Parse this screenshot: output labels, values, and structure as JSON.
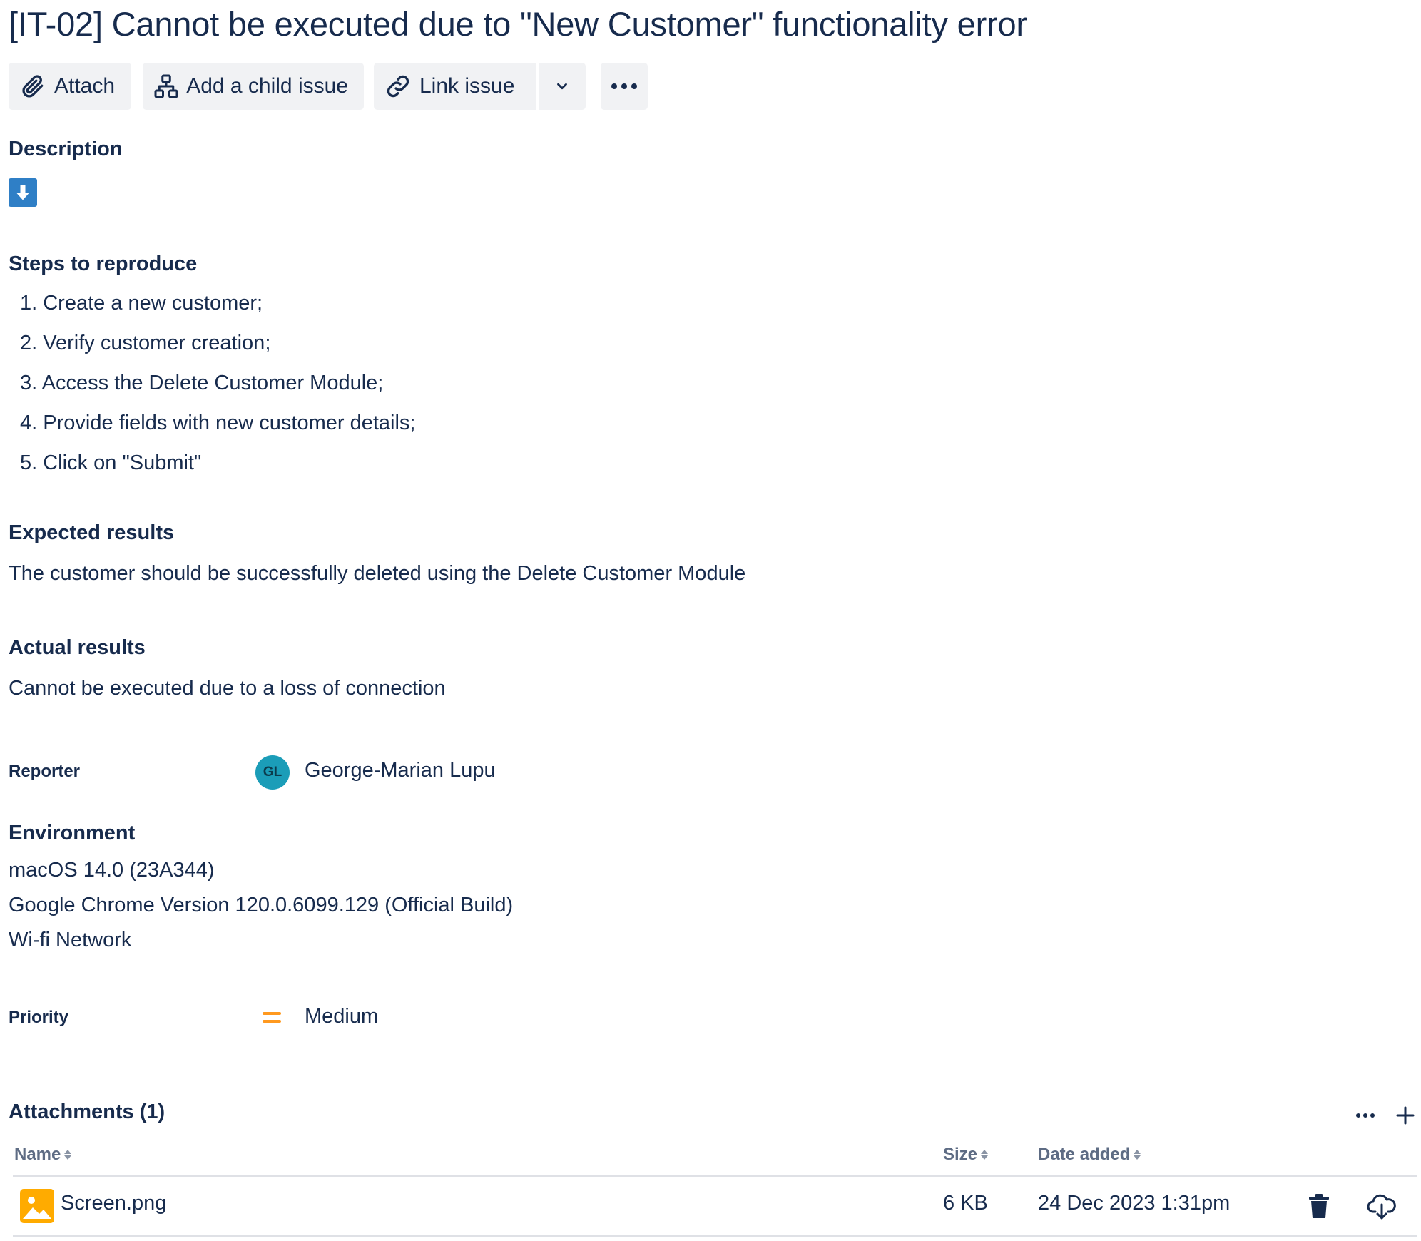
{
  "issue": {
    "title": "[IT-02] Cannot be executed due to \"New Customer\" functionality error"
  },
  "toolbar": {
    "attach_label": "Attach",
    "child_label": "Add a child issue",
    "link_label": "Link issue"
  },
  "description": {
    "heading": "Description",
    "steps_heading": "Steps to reproduce",
    "steps": [
      "1. Create a new customer;",
      "2. Verify customer creation;",
      "3. Access the Delete Customer Module;",
      "4. Provide fields with new customer details;",
      "5. Click on \"Submit\""
    ],
    "expected_heading": "Expected results",
    "expected_text": "The customer should be successfully deleted using the Delete Customer Module",
    "actual_heading": "Actual results",
    "actual_text": "Cannot be executed due to a loss of connection"
  },
  "reporter": {
    "label": "Reporter",
    "initials": "GL",
    "name": "George-Marian Lupu",
    "avatar_color": "#1b9db8"
  },
  "environment": {
    "heading": "Environment",
    "lines": [
      "macOS 14.0 (23A344)",
      "Google Chrome Version 120.0.6099.129 (Official Build)",
      "Wi-fi Network"
    ]
  },
  "priority": {
    "label": "Priority",
    "value": "Medium",
    "icon": "priority-medium-icon",
    "color": "#ff991f"
  },
  "attachments": {
    "heading": "Attachments (1)",
    "columns": {
      "name": "Name",
      "size": "Size",
      "date": "Date added"
    },
    "rows": [
      {
        "name": "Screen.png",
        "size": "6 KB",
        "date": "24 Dec 2023 1:31pm",
        "icon": "image-file-icon"
      }
    ]
  },
  "colors": {
    "text": "#172b4d",
    "button_bg": "#f1f2f4",
    "muted": "#5e6c84",
    "file_icon": "#ffab00"
  }
}
